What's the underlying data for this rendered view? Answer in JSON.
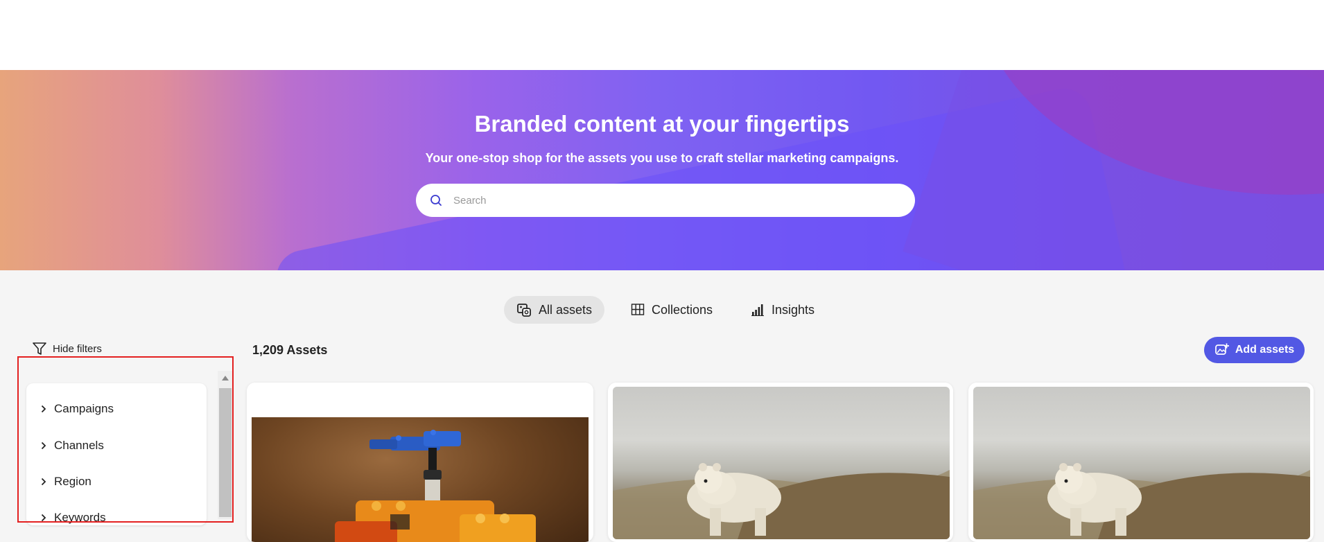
{
  "hero": {
    "title": "Branded content at your fingertips",
    "subtitle": "Your one-stop shop for the assets you use to craft stellar marketing campaigns.",
    "search_placeholder": "Search"
  },
  "tabs": [
    {
      "label": "All assets",
      "icon": "assets-icon",
      "active": true
    },
    {
      "label": "Collections",
      "icon": "grid-icon",
      "active": false
    },
    {
      "label": "Insights",
      "icon": "bar-chart-icon",
      "active": false
    }
  ],
  "toolbar": {
    "hide_filters_label": "Hide filters",
    "asset_count": "1,209 Assets",
    "add_assets_label": "Add assets"
  },
  "filters": [
    {
      "label": "Campaigns"
    },
    {
      "label": "Channels"
    },
    {
      "label": "Region"
    },
    {
      "label": "Keywords"
    }
  ],
  "assets": [
    {
      "type": "image",
      "subject": "lego-toy"
    },
    {
      "type": "image",
      "subject": "polar-bear"
    },
    {
      "type": "image",
      "subject": "polar-bear"
    }
  ],
  "colors": {
    "accent": "#5258e4",
    "highlight_border": "#e32020",
    "hero_gradient_start": "#e7a47c",
    "hero_gradient_mid": "#7f62f2",
    "hero_gradient_end": "#7b4fdc"
  }
}
